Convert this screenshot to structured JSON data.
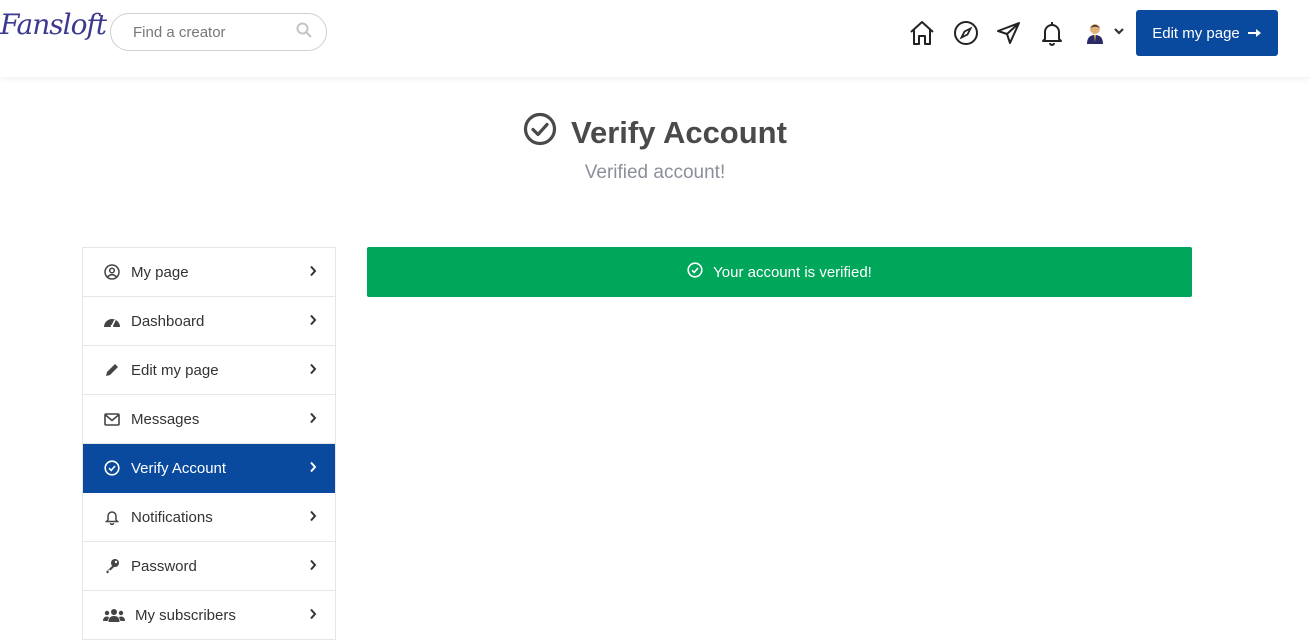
{
  "header": {
    "logo_text": "Fansloft",
    "search_placeholder": "Find a creator",
    "icons": [
      "home-icon",
      "compass-icon",
      "paper-plane-icon",
      "bell-icon",
      "avatar-icon",
      "chevron-down-icon"
    ],
    "edit_button_label": "Edit my page",
    "brand_color": "#0a4a9e"
  },
  "page": {
    "title": "Verify Account",
    "subtitle": "Verified account!"
  },
  "sidebar": {
    "items": [
      {
        "label": "My page",
        "icon": "user-circle-icon"
      },
      {
        "label": "Dashboard",
        "icon": "dashboard-icon"
      },
      {
        "label": "Edit my page",
        "icon": "pencil-icon"
      },
      {
        "label": "Messages",
        "icon": "envelope-icon"
      },
      {
        "label": "Verify Account",
        "icon": "check-circle-icon",
        "active": true
      },
      {
        "label": "Notifications",
        "icon": "bell-icon"
      },
      {
        "label": "Password",
        "icon": "key-icon"
      },
      {
        "label": "My subscribers",
        "icon": "users-icon"
      }
    ]
  },
  "alert": {
    "message": "Your account is verified!",
    "color": "#00a65a"
  }
}
